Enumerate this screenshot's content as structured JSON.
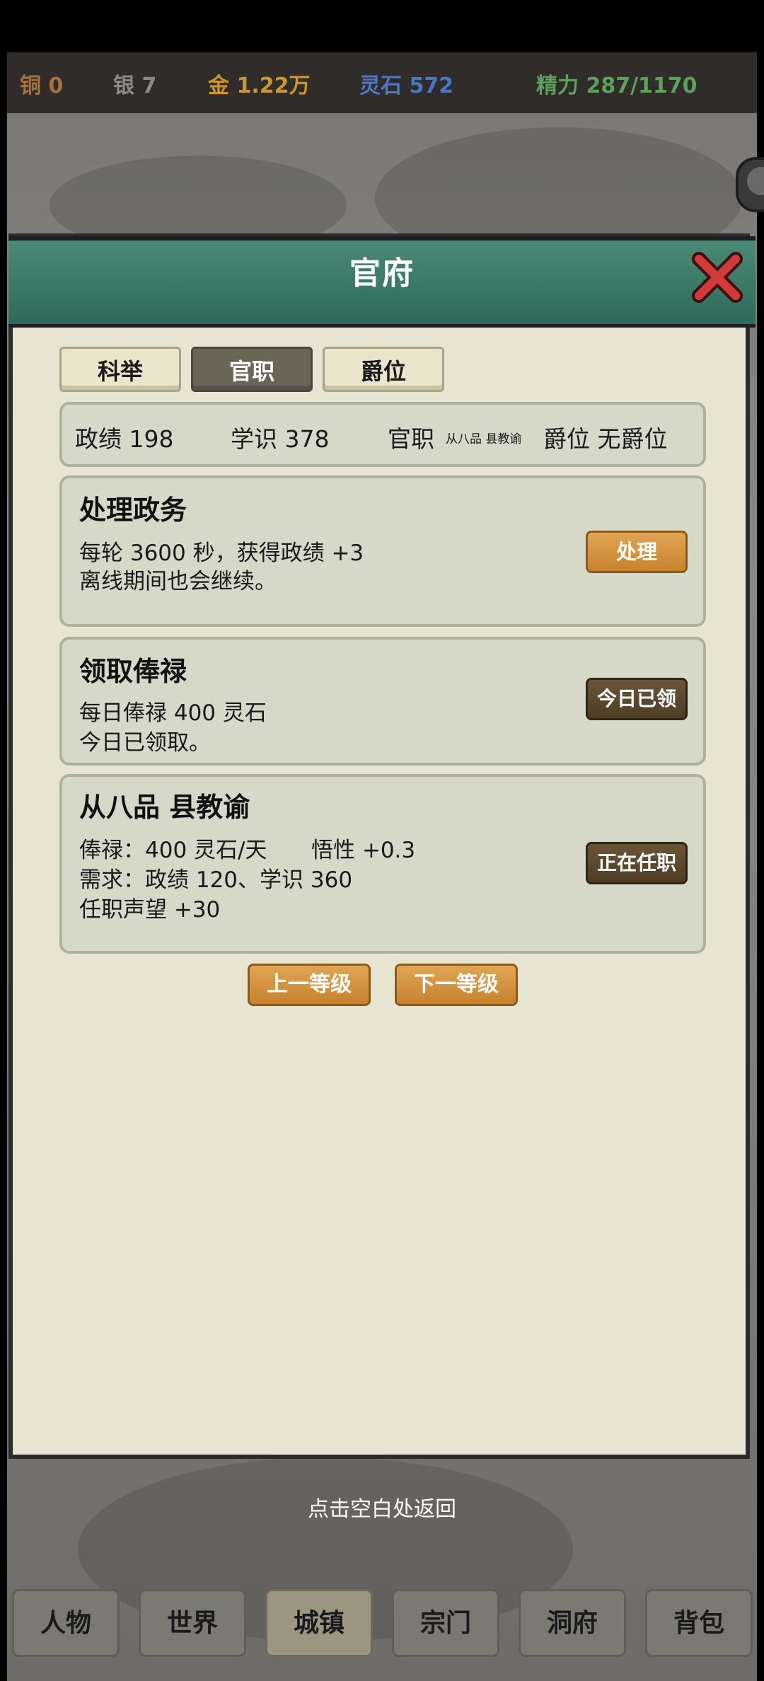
{
  "resources": {
    "copper": "铜 0",
    "silver": "银 7",
    "gold": "金 1.22万",
    "spirit_stone": "灵石 572",
    "energy": "精力 287/1170"
  },
  "colors": {
    "copper": "#a8703f",
    "silver": "#8a8a8a",
    "gold": "#c9962f",
    "spirit_stone": "#4a77c4",
    "energy": "#5aa25a"
  },
  "dialog": {
    "title": "官府",
    "tabs": [
      {
        "label": "科举",
        "active": false
      },
      {
        "label": "官职",
        "active": true
      },
      {
        "label": "爵位",
        "active": false
      }
    ],
    "stats": {
      "merit": "政绩 198",
      "knowledge": "学识 378",
      "post_label": "官职",
      "post_value": "从八品 县教谕",
      "title_rank": "爵位 无爵位"
    },
    "affairs": {
      "title": "处理政务",
      "line1": "每轮 3600 秒，获得政绩 +3",
      "line2": "离线期间也会继续。",
      "button": "处理"
    },
    "salary": {
      "title": "领取俸禄",
      "line1": "每日俸禄 400 灵石",
      "line2": "今日已领取。",
      "button": "今日已领"
    },
    "office": {
      "title": "从八品 县教谕",
      "salary": "俸禄：400 灵石/天",
      "comprehension": "悟性 +0.3",
      "requirement": "需求：政绩 120、学识 360",
      "prestige": "任职声望 +30",
      "button": "正在任职"
    },
    "prev_level": "上一等级",
    "next_level": "下一等级"
  },
  "hint": "点击空白处返回",
  "nav": [
    {
      "label": "人物",
      "active": false
    },
    {
      "label": "世界",
      "active": false
    },
    {
      "label": "城镇",
      "active": true
    },
    {
      "label": "宗门",
      "active": false
    },
    {
      "label": "洞府",
      "active": false
    },
    {
      "label": "背包",
      "active": false
    }
  ],
  "icons": {
    "close": "close-x-icon",
    "side": "round-side-button-icon"
  }
}
